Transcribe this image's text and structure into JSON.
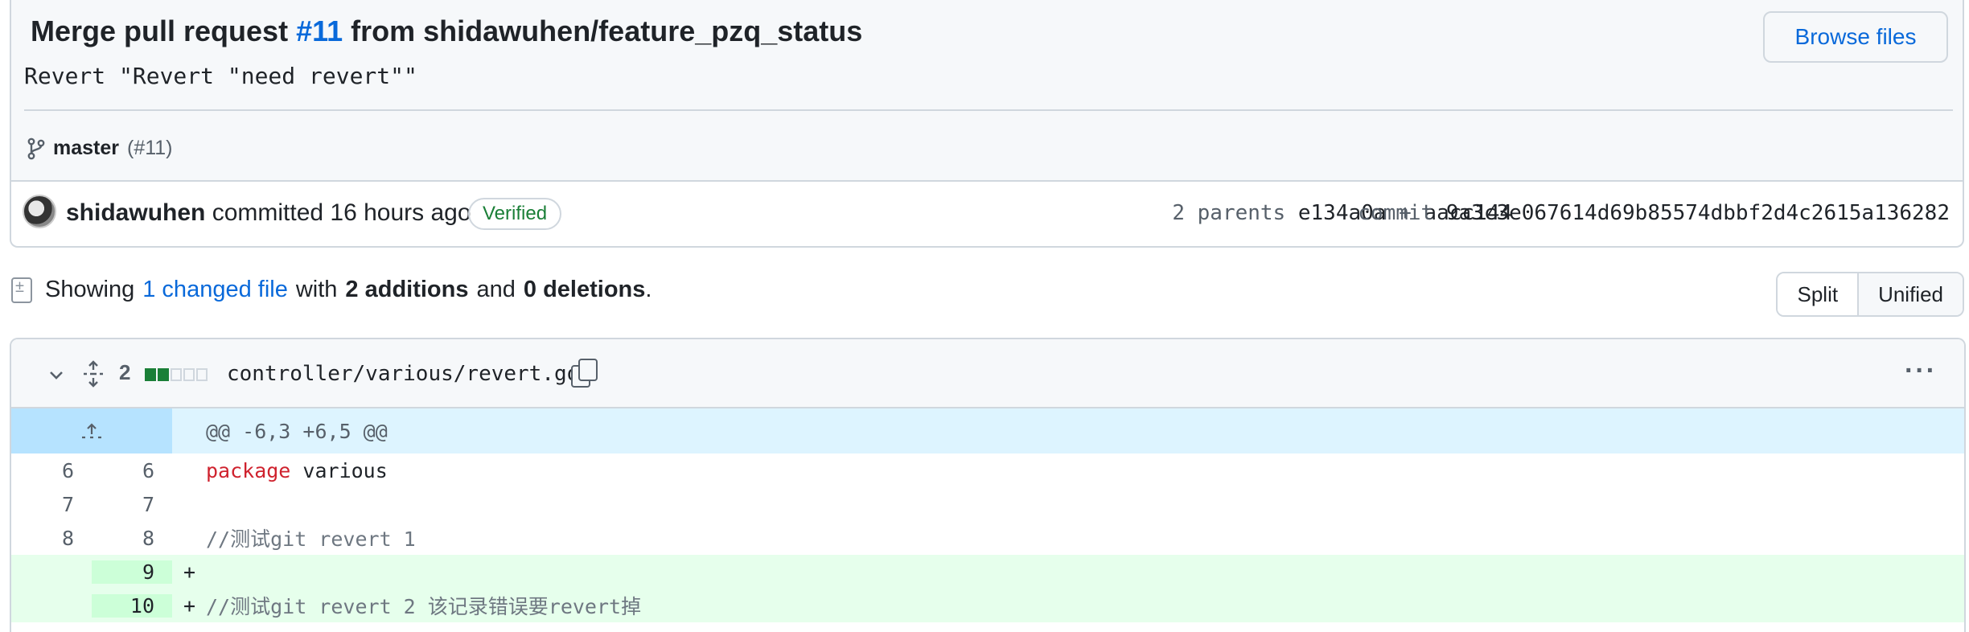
{
  "commit": {
    "title_prefix": "Merge pull request ",
    "pr_ref": "#11",
    "title_suffix": " from shidawuhen/feature_pzq_status",
    "description": "Revert \"Revert \"need revert\"\"",
    "branch": "master",
    "branch_pr": "(#11)",
    "browse_files_label": "Browse files",
    "author": "shidawuhen",
    "committed_text": " committed 16 hours ago",
    "verified_label": "Verified",
    "parents_label": "2 parents",
    "parent1": "e134a0a",
    "parent_join": "+",
    "parent2": "aacc144",
    "commit_label": "commit",
    "sha": "9a3c3e067614d69b85574dbbf2d4c2615a136282"
  },
  "summary": {
    "showing": "Showing",
    "changed_files": "1 changed file",
    "with": "with",
    "additions": "2 additions",
    "and": "and",
    "deletions": "0 deletions",
    "period": "."
  },
  "view_toggle": {
    "split": "Split",
    "unified": "Unified",
    "selected": "Unified"
  },
  "file": {
    "changes": "2",
    "path": "controller/various/revert.go",
    "diffstat": [
      "add",
      "add",
      "neutral",
      "neutral",
      "neutral"
    ],
    "hunk_header": "@@ -6,3 +6,5 @@",
    "lines": [
      {
        "type": "context",
        "old": "6",
        "new": "6",
        "keyword": "package",
        "text": " various"
      },
      {
        "type": "context",
        "old": "7",
        "new": "7",
        "text": ""
      },
      {
        "type": "context",
        "old": "8",
        "new": "8",
        "comment": "//测试git revert 1"
      },
      {
        "type": "add",
        "old": "",
        "new": "9",
        "marker": "+",
        "text": ""
      },
      {
        "type": "add",
        "old": "",
        "new": "10",
        "marker": "+",
        "comment": "//测试git revert 2 该记录错误要revert掉"
      }
    ]
  },
  "icons": {
    "branch": "git-branch-icon",
    "expand": "unfold-icon",
    "copy": "copy-icon",
    "more": "kebab-horizontal-icon",
    "chevron": "chevron-down-icon",
    "expand_up": "fold-up-icon",
    "diff": "file-diff-icon"
  },
  "colors": {
    "link": "#0969da",
    "verified": "#1a7f37",
    "addition_bg": "#e6ffec",
    "hunk_bg": "#ddf4ff",
    "keyword": "#cf222e"
  }
}
